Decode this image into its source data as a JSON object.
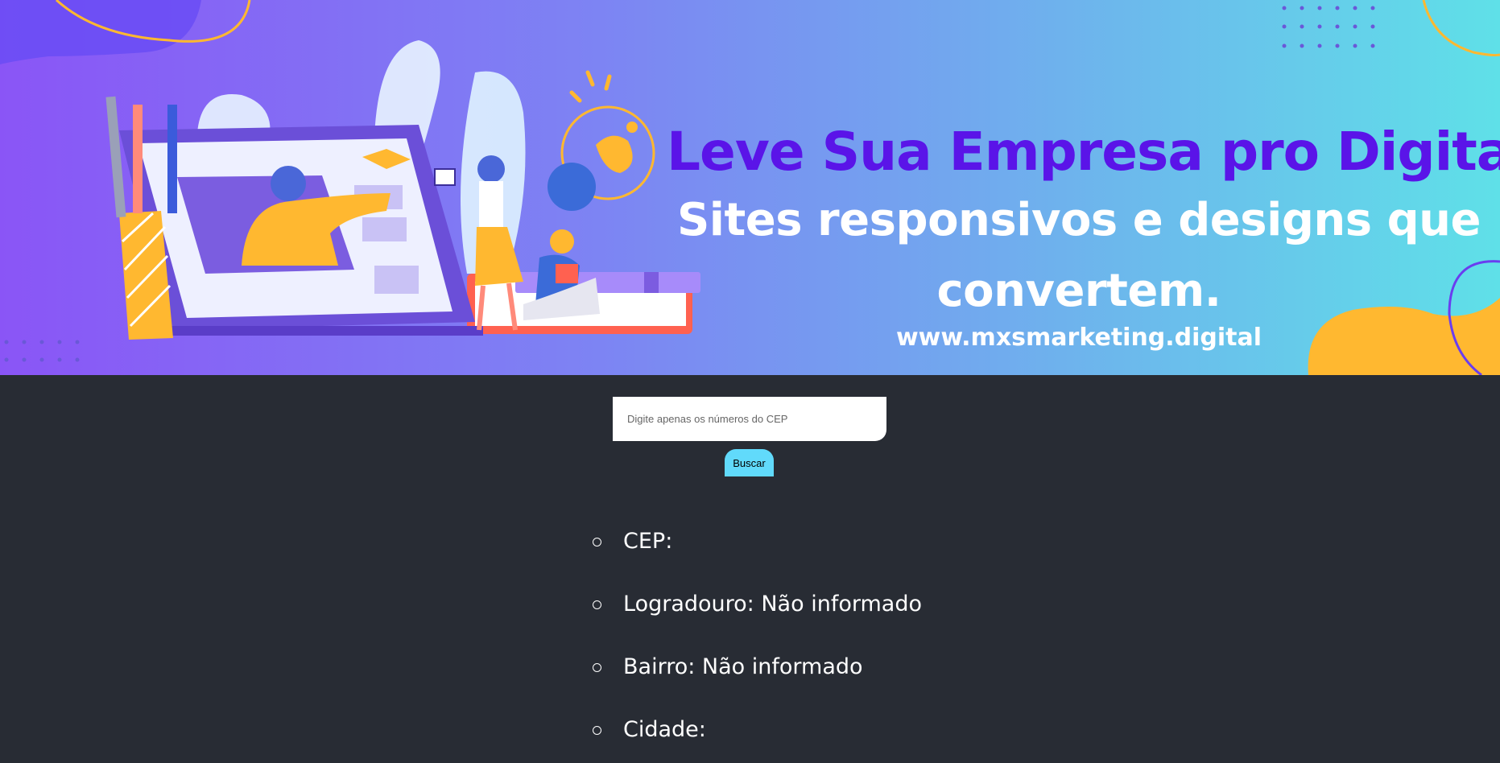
{
  "banner": {
    "headline": "Leve Sua Empresa pro Digital!",
    "subline": "Sites responsivos e designs que convertem.",
    "url": "www.mxsmarketing.digital",
    "colors": {
      "gradient_start": "#8a55f6",
      "gradient_end": "#5fe0e8",
      "headline": "#5a14e8",
      "accent_yellow": "#ffb830"
    }
  },
  "search": {
    "placeholder": "Digite apenas os números do CEP",
    "value": "",
    "button_label": "Buscar",
    "button_color": "#61dafb"
  },
  "result": {
    "items": [
      {
        "label": "CEP:",
        "value": ""
      },
      {
        "label": "Logradouro:",
        "value": "Não informado"
      },
      {
        "label": "Bairro:",
        "value": "Não informado"
      },
      {
        "label": "Cidade:",
        "value": ""
      }
    ]
  },
  "theme": {
    "background": "#282c34"
  }
}
